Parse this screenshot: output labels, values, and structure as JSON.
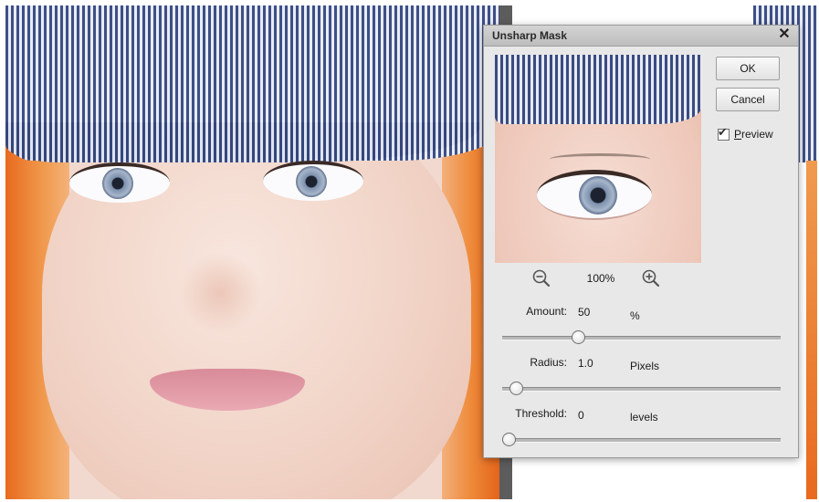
{
  "dialog": {
    "title": "Unsharp Mask",
    "close_glyph": "✕",
    "ok_label": "OK",
    "cancel_label": "Cancel",
    "preview_label": "Preview",
    "preview_checked": true,
    "zoom": {
      "value": "100%",
      "zoom_out_icon": "zoom-out-magnifier",
      "zoom_in_icon": "zoom-in-magnifier"
    },
    "amount": {
      "label": "Amount:",
      "value": "50",
      "unit": "%",
      "slider_fraction": 0.27
    },
    "radius": {
      "label": "Radius:",
      "value": "1.0",
      "unit": "Pixels",
      "slider_fraction": 0.045
    },
    "threshold": {
      "label": "Threshold:",
      "value": "0",
      "unit": "levels",
      "slider_fraction": 0.0
    }
  },
  "colors": {
    "dialog_bg": "#e8e8e8",
    "hair": "#e86a1e",
    "cap_stripe": "#3e4f86"
  }
}
